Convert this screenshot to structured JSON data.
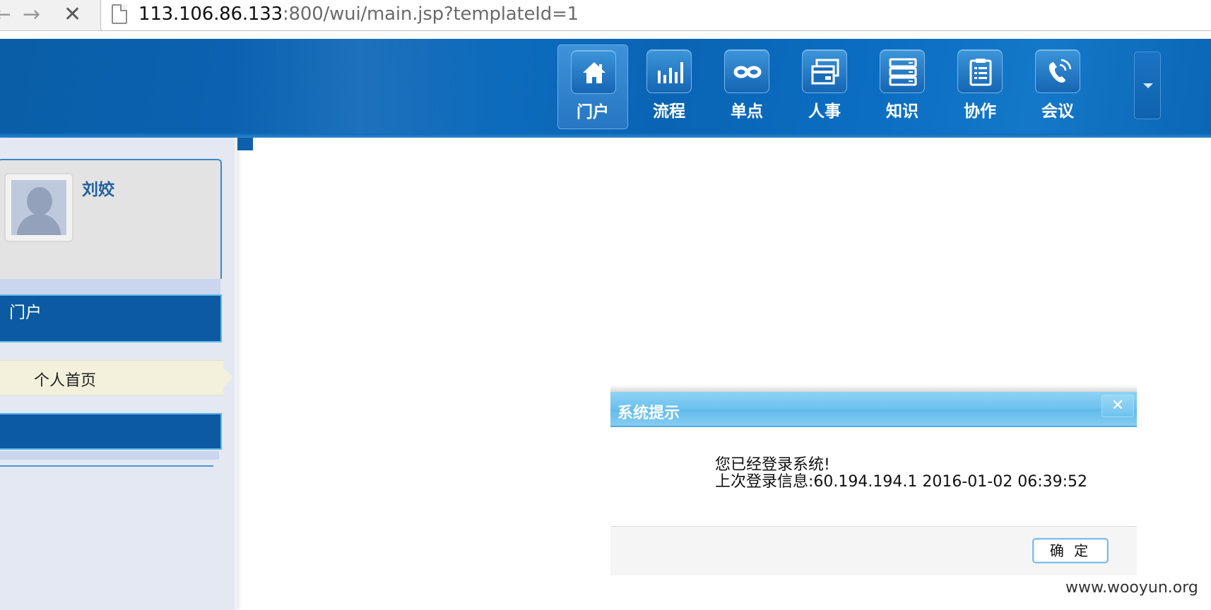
{
  "browser": {
    "url_host": "113.106.86.133",
    "url_path": ":800/wui/main.jsp?templateId=1",
    "back_glyph": "←",
    "forward_glyph": "→",
    "stop_glyph": "✕"
  },
  "header": {
    "nav_items": [
      {
        "label": "门户",
        "icon": "home-icon",
        "active": true
      },
      {
        "label": "流程",
        "icon": "bar-chart-icon",
        "active": false
      },
      {
        "label": "单点",
        "icon": "infinity-icon",
        "active": false
      },
      {
        "label": "人事",
        "icon": "id-cards-icon",
        "active": false
      },
      {
        "label": "知识",
        "icon": "server-stack-icon",
        "active": false
      },
      {
        "label": "协作",
        "icon": "clipboard-icon",
        "active": false
      },
      {
        "label": "会议",
        "icon": "phone-icon",
        "active": false
      }
    ]
  },
  "sidebar": {
    "user_name": "刘姣",
    "menu_portal_label": "门户",
    "submenu_label": "个人首页"
  },
  "dialog": {
    "title": "系统提示",
    "close_glyph": "✕",
    "message_line1": "您已经登录系统!",
    "message_line2": "上次登录信息:60.194.194.1 2016-01-02 06:39:52",
    "ok_label": "确 定"
  },
  "watermark": "www.wooyun.org",
  "colors": {
    "header_blue": "#0a63b3",
    "menu_blue": "#0b5aa2",
    "dialog_title_blue": "#6fc3ef"
  }
}
